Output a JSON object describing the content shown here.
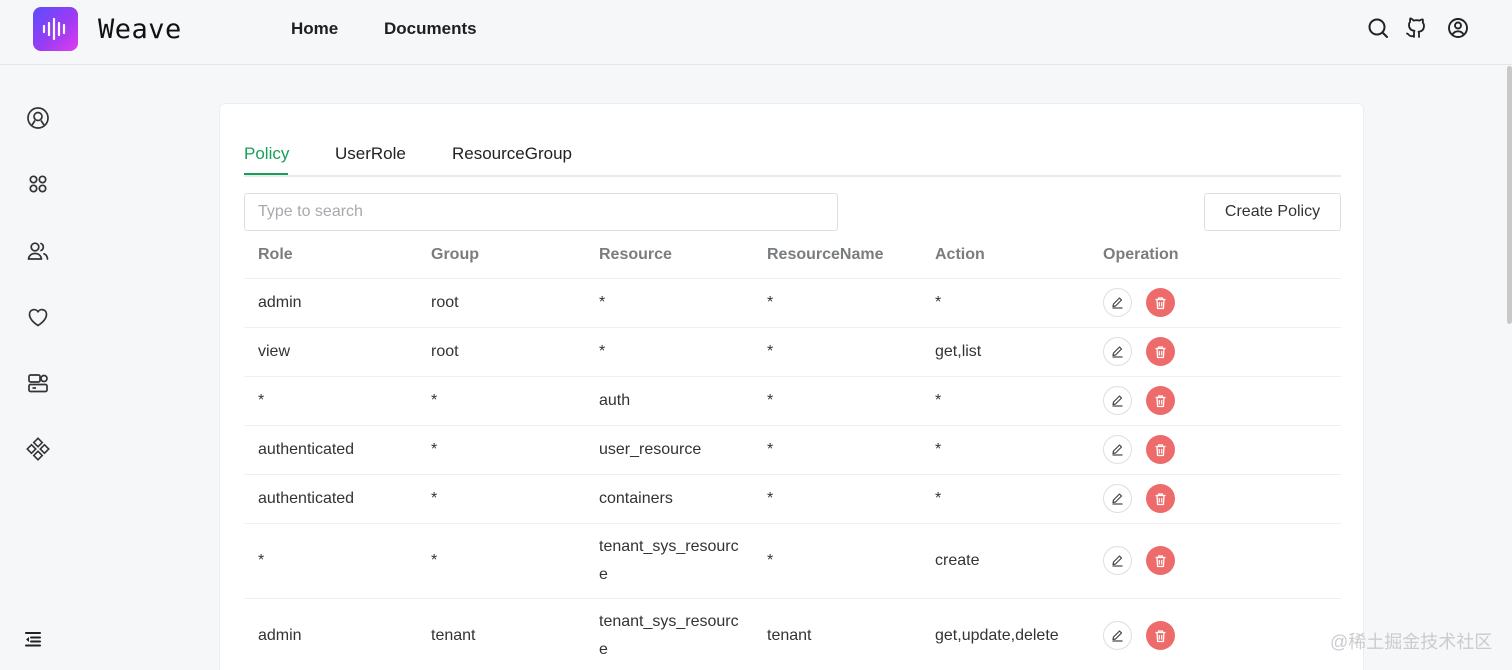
{
  "header": {
    "brand": "Weave",
    "nav": [
      {
        "label": "Home"
      },
      {
        "label": "Documents"
      }
    ],
    "icons": [
      "search-icon",
      "github-icon",
      "user-circle-icon"
    ]
  },
  "sidebar": {
    "icons": [
      "dashboard-icon",
      "apps-icon",
      "users-icon",
      "heart-icon",
      "server-icon",
      "components-icon",
      "collapse-menu-icon"
    ]
  },
  "tabs": [
    {
      "label": "Policy",
      "active": true
    },
    {
      "label": "UserRole",
      "active": false
    },
    {
      "label": "ResourceGroup",
      "active": false
    }
  ],
  "search": {
    "placeholder": "Type to search",
    "value": ""
  },
  "create_button": "Create Policy",
  "table": {
    "columns": [
      "Role",
      "Group",
      "Resource",
      "ResourceName",
      "Action",
      "Operation"
    ],
    "rows": [
      {
        "role": "admin",
        "group": "root",
        "resource": "*",
        "resource_name": "*",
        "action": "*"
      },
      {
        "role": "view",
        "group": "root",
        "resource": "*",
        "resource_name": "*",
        "action": "get,list"
      },
      {
        "role": "*",
        "group": "*",
        "resource": "auth",
        "resource_name": "*",
        "action": "*"
      },
      {
        "role": "authenticated",
        "group": "*",
        "resource": "user_resource",
        "resource_name": "*",
        "action": "*"
      },
      {
        "role": "authenticated",
        "group": "*",
        "resource": "containers",
        "resource_name": "*",
        "action": "*"
      },
      {
        "role": "*",
        "group": "*",
        "resource": "tenant_sys_resource",
        "resource_name": "*",
        "action": "create"
      },
      {
        "role": "admin",
        "group": "tenant",
        "resource": "tenant_sys_resource",
        "resource_name": "tenant",
        "action": "get,update,delete"
      }
    ]
  },
  "colors": {
    "accent": "#18a058",
    "danger": "#ee6b6b",
    "logo_gradient": [
      "#5b4dff",
      "#e03df0"
    ]
  },
  "watermark": "@稀土掘金技术社区"
}
